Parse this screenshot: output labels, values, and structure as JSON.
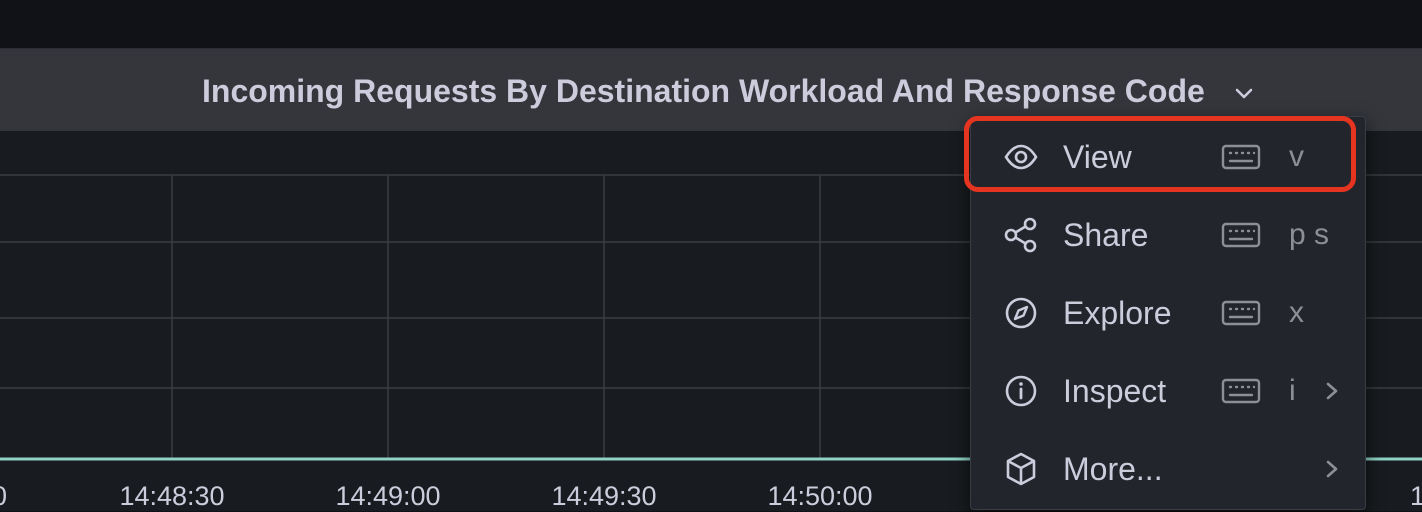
{
  "panel": {
    "title": "Incoming Requests By Destination Workload And Response Code"
  },
  "time_axis": {
    "ticks": [
      "14:48:30",
      "14:49:00",
      "14:49:30",
      "14:50:00"
    ],
    "edge_left": "0",
    "edge_right": "1"
  },
  "colors": {
    "highlight": "#e5341f",
    "series_line": "#73bf69"
  },
  "menu": {
    "items": [
      {
        "label": "View",
        "icon": "eye-icon",
        "shortcut": "v",
        "submenu": false
      },
      {
        "label": "Share",
        "icon": "share-icon",
        "shortcut": "p s",
        "submenu": false
      },
      {
        "label": "Explore",
        "icon": "compass-icon",
        "shortcut": "x",
        "submenu": false
      },
      {
        "label": "Inspect",
        "icon": "info-icon",
        "shortcut": "i",
        "submenu": true
      },
      {
        "label": "More...",
        "icon": "cube-icon",
        "shortcut": "",
        "submenu": true
      }
    ]
  }
}
